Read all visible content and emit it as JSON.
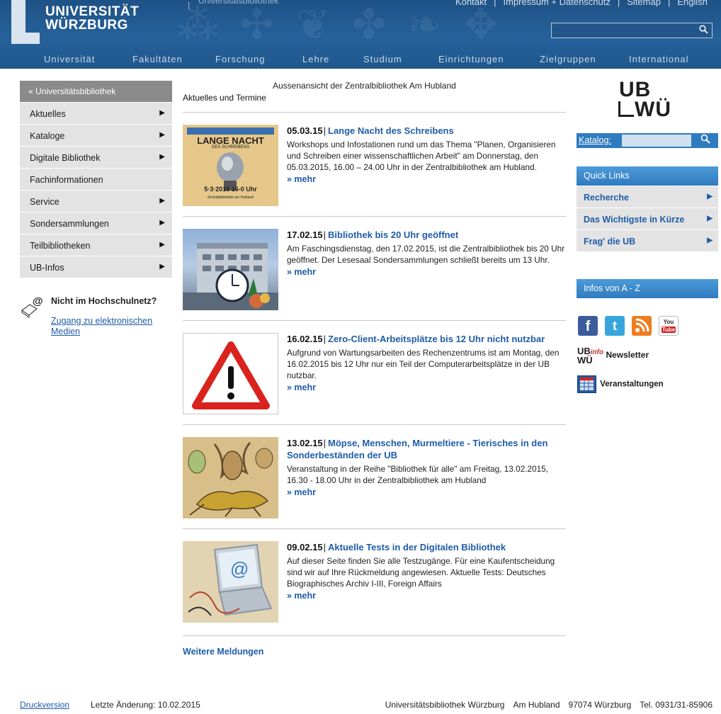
{
  "header": {
    "logo_line1": "UNIVERSITÄT",
    "logo_line2": "WÜRZBURG",
    "top_ub": "Universitätsbibliothek",
    "top_links": [
      "Kontakt",
      "|",
      "Impressum + Datenschutz",
      "|",
      "Sitemap",
      "|",
      "English"
    ],
    "search_placeholder": "",
    "search_icon": "search-icon"
  },
  "mainnav": [
    "Universität",
    "Fakultäten",
    "Forschung",
    "Lehre",
    "Studium",
    "Einrichtungen",
    "Zielgruppen",
    "International"
  ],
  "leftnav": {
    "head": "Universitätsbibliothek",
    "head_icon": "«",
    "items": [
      {
        "label": "Aktuelles",
        "arrow": "▶"
      },
      {
        "label": "Kataloge",
        "arrow": "▶"
      },
      {
        "label": "Digitale Bibliothek",
        "arrow": "▶"
      },
      {
        "label": "Fachinformationen",
        "arrow": ""
      },
      {
        "label": "Service",
        "arrow": "▶"
      },
      {
        "label": "Sondersammlungen",
        "arrow": "▶"
      },
      {
        "label": "Teilbibliotheken",
        "arrow": "▶"
      },
      {
        "label": "UB-Infos",
        "arrow": "▶"
      }
    ]
  },
  "hochschulnetz": {
    "title": "Nicht im Hochschulnetz?",
    "link": "Zugang zu elektronischen Medien"
  },
  "center": {
    "image_caption": "Aussenansicht der Zentralbibliothek Am Hubland",
    "section_title": "Aktuelles und Termine",
    "news": [
      {
        "date": "05.03.15",
        "title": "Lange Nacht des Schreibens",
        "text": "Workshops und Infostationen rund um das Thema \"Planen, Organisieren und Schreiben einer wissenschaftlichen Arbeit\" am Donnerstag, den 05.03.2015, 16.00 – 24.00 Uhr in der Zentralbibliothek am Hubland.",
        "more": "» mehr",
        "poster_title": "LANGE NACHT",
        "poster_sub": "DES SCHREIBENS",
        "poster_date": "5·3·2015  16-0 Uhr",
        "poster_place": "Zentralbibliothek am Hubland"
      },
      {
        "date": "17.02.15",
        "title": "Bibliothek bis 20 Uhr geöffnet",
        "text": "Am Faschingsdienstag, den 17.02.2015, ist die Zentralbibliothek bis 20 Uhr geöffnet. Der Lesesaal Sondersammlungen schließt bereits um 13 Uhr.",
        "more": "» mehr"
      },
      {
        "date": "16.02.15",
        "title": "Zero-Client-Arbeitsplätze bis 12 Uhr nicht nutzbar",
        "text": "Aufgrund von Wartungsarbeiten des Rechenzentrums ist am Montag, den 16.02.2015 bis 12 Uhr nur ein Teil der Computerarbeitsplätze in der UB nutzbar.",
        "more": "» mehr"
      },
      {
        "date": "13.02.15",
        "title": "Möpse, Menschen, Murmeltiere - Tierisches in den Sonderbeständen der UB",
        "text": "Veranstaltung in der Reihe \"Bibliothek für alle\" am Freitag, 13.02.2015, 16.30 - 18.00 Uhr in der Zentralbibliothek am Hubland",
        "more": "» mehr"
      },
      {
        "date": "09.02.15",
        "title": "Aktuelle Tests in der Digitalen Bibliothek",
        "text": "Auf dieser Seite finden Sie alle Testzugänge. Für eine Kaufentscheidung sind wir auf Ihre Rückmeldung angewiesen. Aktuelle Tests: Deutsches Biographisches Archiv I-III, Foreign Affairs",
        "more": "» mehr"
      }
    ],
    "weitere": "Weitere Meldungen"
  },
  "right": {
    "logo_ub": "UB",
    "logo_wu": "WÜ",
    "katalog_label": "Katalog:",
    "katalog_btn": "🔍",
    "quicklinks_head": "Quick Links",
    "quicklinks": [
      {
        "label": "Recherche",
        "arrow": "▶"
      },
      {
        "label": "Das Wichtigste in Kürze",
        "arrow": "▶"
      },
      {
        "label": "Frag' die UB",
        "arrow": "▶"
      }
    ],
    "infos_az": "Infos von A - Z",
    "social": {
      "facebook": "f",
      "twitter": "t",
      "youtube_top": "You",
      "youtube_bottom": "Tube"
    },
    "newsletter_logo_ub": "UB",
    "newsletter_logo_info": "info",
    "newsletter_logo_wu": "WÜ",
    "newsletter": "Newsletter",
    "veranstaltungen": "Veranstaltungen"
  },
  "footer": {
    "druckversion": "Druckversion",
    "last_change": "Letzte Änderung: 10.02.2015",
    "address": [
      "Universitätsbibliothek Würzburg",
      "Am Hubland",
      "97074 Würzburg",
      "Tel. 0931/31-85906"
    ]
  },
  "colors": {
    "header_blue": "#26619a",
    "link_blue": "#1f5ca8",
    "accent_blue": "#2f7bbf",
    "nav_grey": "#e3e3e3"
  }
}
